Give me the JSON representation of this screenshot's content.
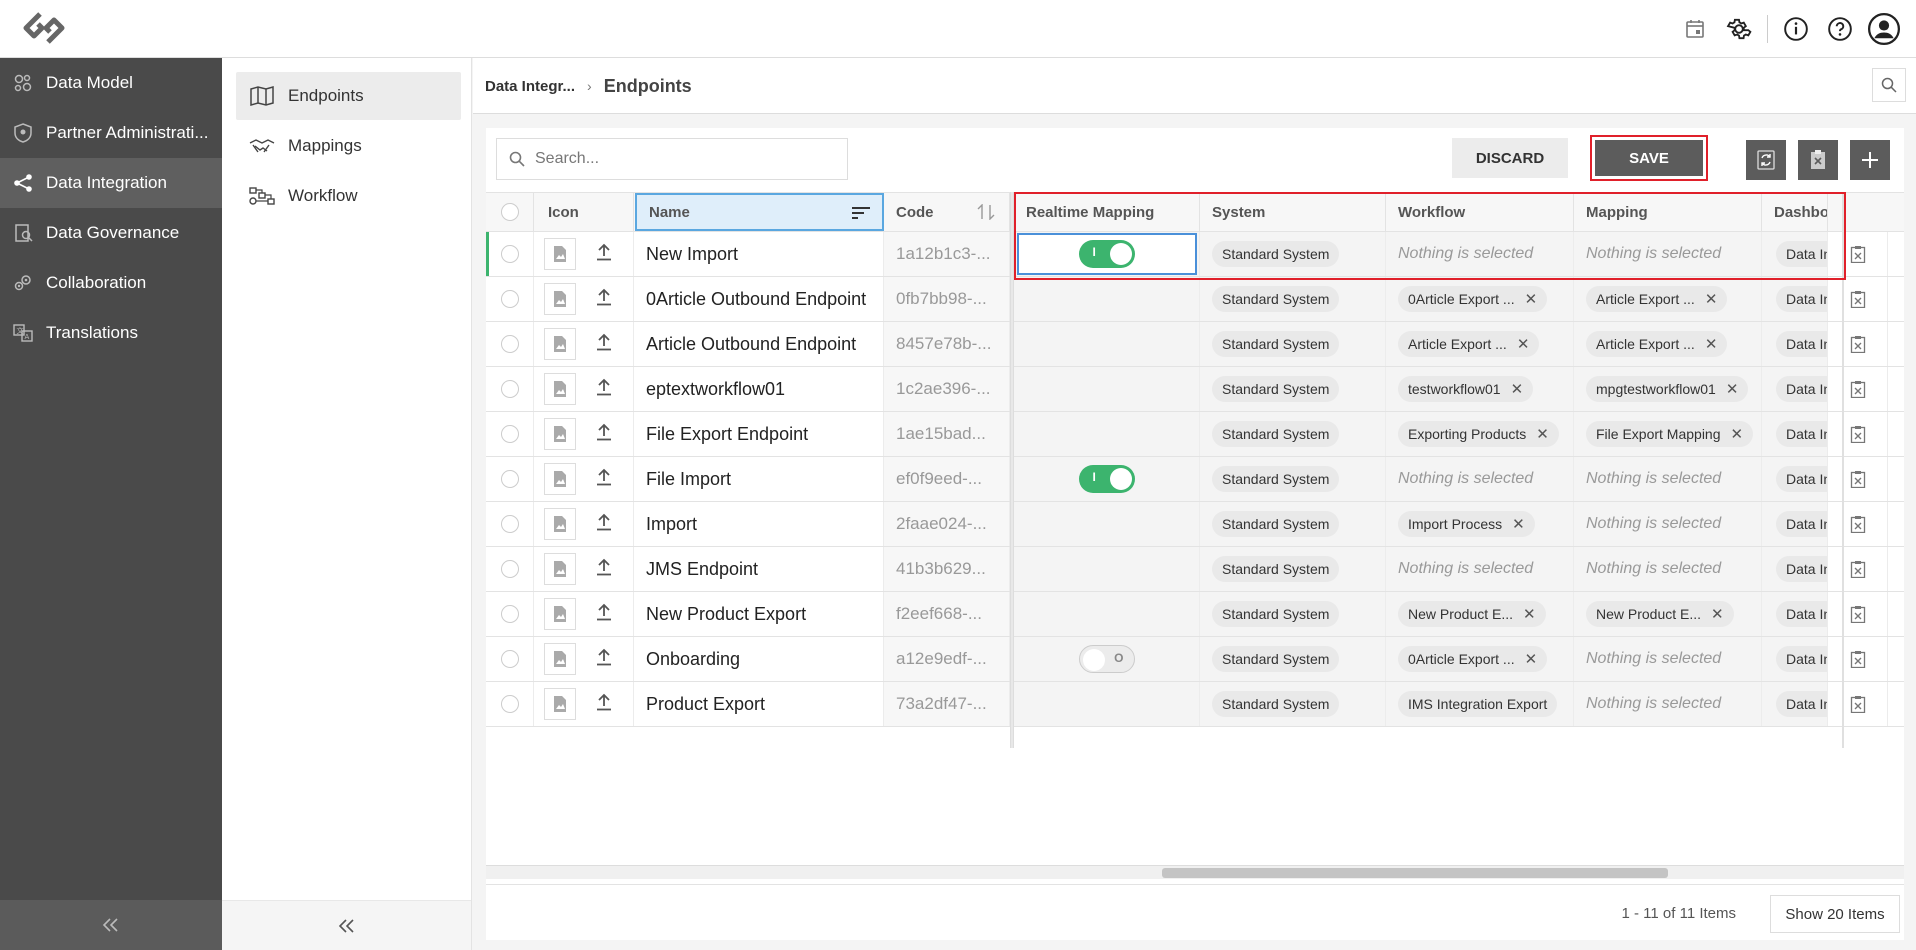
{
  "topbar": {
    "icons": [
      "logo-icon",
      "calendar-icon",
      "gear-icon",
      "info-icon",
      "help-icon",
      "user-avatar-icon"
    ]
  },
  "sidebar": {
    "items": [
      {
        "label": "Data Model",
        "icon": "data-model-icon"
      },
      {
        "label": "Partner Administrati...",
        "icon": "shield-icon"
      },
      {
        "label": "Data Integration",
        "icon": "share-icon",
        "active": true
      },
      {
        "label": "Data Governance",
        "icon": "governance-icon"
      },
      {
        "label": "Collaboration",
        "icon": "collaboration-icon"
      },
      {
        "label": "Translations",
        "icon": "translations-icon"
      }
    ]
  },
  "subnav": {
    "items": [
      {
        "label": "Endpoints",
        "icon": "map-icon",
        "active": true
      },
      {
        "label": "Mappings",
        "icon": "handshake-icon"
      },
      {
        "label": "Workflow",
        "icon": "workflow-icon"
      }
    ]
  },
  "breadcrumb": {
    "parent": "Data Integr...",
    "separator": "›",
    "current": "Endpoints"
  },
  "toolbar": {
    "search_placeholder": "Search...",
    "discard_label": "DISCARD",
    "save_label": "SAVE"
  },
  "columns": {
    "icon": "Icon",
    "name": "Name",
    "code": "Code",
    "realtime": "Realtime Mapping",
    "system": "System",
    "workflow": "Workflow",
    "mapping": "Mapping",
    "dashboard": "Dashboa"
  },
  "rows": [
    {
      "name": "New Import",
      "code": "1a12b1c3-...",
      "realtime": "on",
      "system": "Standard System",
      "workflow": "",
      "mapping": "",
      "dashboard": "Data Inte"
    },
    {
      "name": "0Article Outbound Endpoint",
      "code": "0fb7bb98-...",
      "realtime": "",
      "system": "Standard System",
      "workflow": "0Article Export ...",
      "mapping": "Article Export ...",
      "dashboard": "Data Inte"
    },
    {
      "name": "Article Outbound Endpoint",
      "code": "8457e78b-...",
      "realtime": "",
      "system": "Standard System",
      "workflow": "Article Export ...",
      "mapping": "Article Export ...",
      "dashboard": "Data Inte"
    },
    {
      "name": "eptextworkflow01",
      "code": "1c2ae396-...",
      "realtime": "",
      "system": "Standard System",
      "workflow": "testworkflow01",
      "mapping": "mpgtestworkflow01",
      "dashboard": "Data Inte"
    },
    {
      "name": "File Export Endpoint",
      "code": "1ae15bad...",
      "realtime": "",
      "system": "Standard System",
      "workflow": "Exporting Products",
      "mapping": "File Export Mapping",
      "dashboard": "Data Inte"
    },
    {
      "name": "File Import",
      "code": "ef0f9eed-...",
      "realtime": "on",
      "system": "Standard System",
      "workflow": "",
      "mapping": "",
      "dashboard": "Data Inte"
    },
    {
      "name": "Import",
      "code": "2faae024-...",
      "realtime": "",
      "system": "Standard System",
      "workflow": "Import Process",
      "mapping": "",
      "dashboard": "Data Inte"
    },
    {
      "name": "JMS Endpoint",
      "code": "41b3b629...",
      "realtime": "",
      "system": "Standard System",
      "workflow": "",
      "mapping": "",
      "dashboard": "Data Inte"
    },
    {
      "name": "New Product Export",
      "code": "f2eef668-...",
      "realtime": "",
      "system": "Standard System",
      "workflow": "New Product E...",
      "mapping": "New Product E...",
      "dashboard": "Data Inte"
    },
    {
      "name": "Onboarding",
      "code": "a12e9edf-...",
      "realtime": "off",
      "system": "Standard System",
      "workflow": "0Article Export ...",
      "mapping": "",
      "dashboard": "Data Inte"
    },
    {
      "name": "Product Export",
      "code": "73a2df47-...",
      "realtime": "",
      "system": "Standard System",
      "workflow": "IMS Integration Export",
      "mapping": "",
      "dashboard": "Data Inte"
    }
  ],
  "empty_text": "Nothing is selected",
  "toggle_on_label": "I",
  "toggle_off_label": "O",
  "pagination": {
    "info": "1 - 11 of 11 Items",
    "show_label": "Show 20 Items"
  }
}
